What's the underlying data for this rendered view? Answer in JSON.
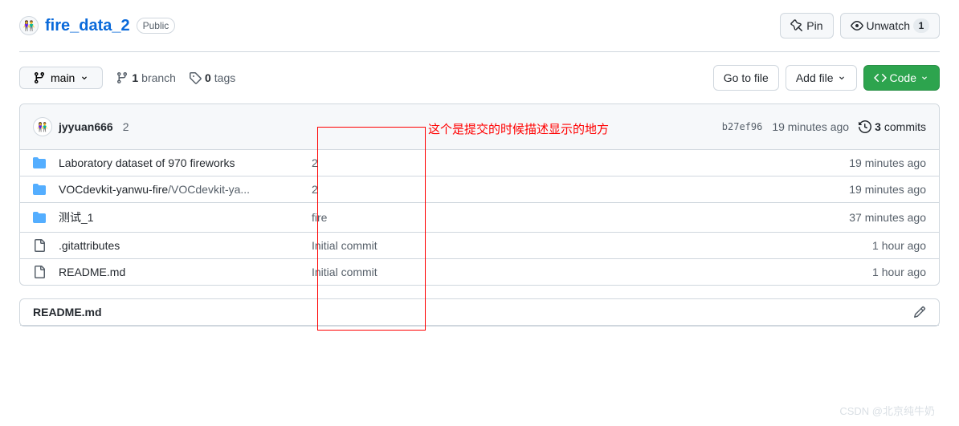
{
  "repo": {
    "name": "fire_data_2",
    "visibility": "Public",
    "avatar_emoji": "👫"
  },
  "header_actions": {
    "pin_label": "Pin",
    "unwatch_label": "Unwatch",
    "unwatch_count": "1"
  },
  "branch_selector": {
    "current": "main"
  },
  "branch_info": {
    "branch_count": "1",
    "branch_label": "branch",
    "tag_count": "0",
    "tag_label": "tags"
  },
  "file_actions": {
    "go_to_file": "Go to file",
    "add_file": "Add file",
    "code": "Code"
  },
  "latest_commit": {
    "avatar_emoji": "👫",
    "author": "jyyuan666",
    "message": "2",
    "sha": "b27ef96",
    "time": "19 minutes ago",
    "commits_count": "3",
    "commits_label": "commits"
  },
  "files": [
    {
      "type": "dir",
      "name": "Laboratory dataset of 970 fireworks",
      "name_muted": "",
      "commit_msg": "2",
      "time": "19 minutes ago"
    },
    {
      "type": "dir",
      "name": "VOCdevkit-yanwu-fire",
      "name_muted": "/VOCdevkit-ya...",
      "commit_msg": "2",
      "time": "19 minutes ago"
    },
    {
      "type": "dir",
      "name": "测试_1",
      "name_muted": "",
      "commit_msg": "fire",
      "time": "37 minutes ago"
    },
    {
      "type": "file",
      "name": ".gitattributes",
      "name_muted": "",
      "commit_msg": "Initial commit",
      "time": "1 hour ago"
    },
    {
      "type": "file",
      "name": "README.md",
      "name_muted": "",
      "commit_msg": "Initial commit",
      "time": "1 hour ago"
    }
  ],
  "readme": {
    "filename": "README.md"
  },
  "annotation": {
    "text": "这个是提交的时候描述显示的地方"
  },
  "watermark": "CSDN @北京纯牛奶"
}
